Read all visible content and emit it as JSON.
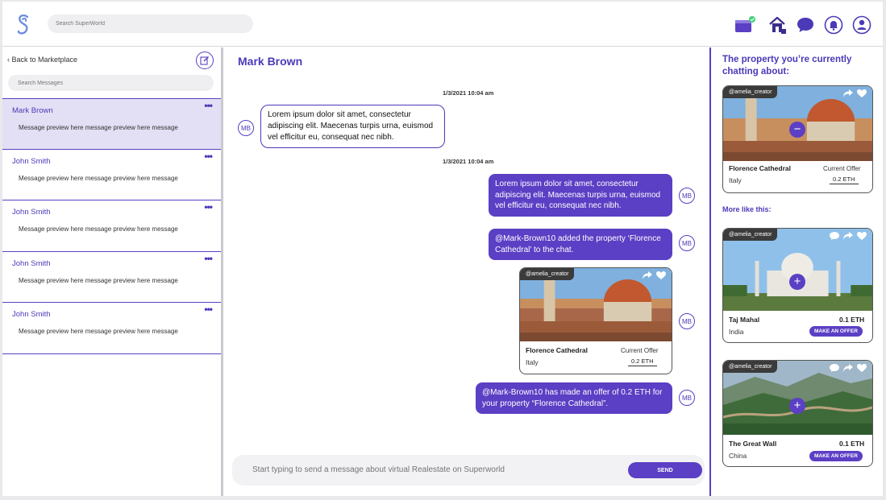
{
  "header": {
    "search_placeholder": "Search SuperWorld"
  },
  "sidebar": {
    "back_label": "Back to Marketplace",
    "search_placeholder": "Search Messages",
    "conversations": [
      {
        "name": "Mark Brown",
        "preview": "Message preview here message preview here message",
        "active": true
      },
      {
        "name": "John Smith",
        "preview": "Message preview here message preview here message"
      },
      {
        "name": "John Smith",
        "preview": "Message preview here message preview here message"
      },
      {
        "name": "John Smith",
        "preview": "Message preview here message preview here message"
      },
      {
        "name": "John Smith",
        "preview": "Message preview here message preview here message"
      }
    ],
    "more_glyph": "•••"
  },
  "chat": {
    "title": "Mark Brown",
    "timestamp_1": "1/3/2021 10:04 am",
    "timestamp_2": "1/3/2021 10:04 am",
    "avatar_initials": "MB",
    "msg_in_1": "Lorem ipsum dolor sit amet, consectetur adipiscing elit. Maecenas turpis urna, euismod vel efficitur eu, consequat nec nibh.",
    "msg_out_1": "Lorem ipsum dolor sit amet, consectetur adipiscing elit. Maecenas turpis urna, euismod vel efficitur eu, consequat nec nibh.",
    "msg_out_2": "@Mark-Brown10 added the property ‘Florence Cathedral’ to the chat.",
    "msg_out_3": "@Mark-Brown10 has made an offer of 0.2 ETH for your property “Florence Cathedral”.",
    "card": {
      "owner": "@amelia_creator",
      "name": "Florence Cathedral",
      "country": "Italy",
      "offer_label": "Current Offer",
      "offer_value": "0.2 ETH"
    },
    "composer_placeholder": "Start typing to send a message about virtual Realestate on Superworld",
    "send_label": "SEND"
  },
  "right": {
    "title": "The property you’re currently chatting about:",
    "current": {
      "owner": "@amelia_creator",
      "name": "Florence Cathedral",
      "country": "Italy",
      "offer_label": "Current Offer",
      "offer_value": "0.2 ETH"
    },
    "more_title": "More like this:",
    "suggestions": [
      {
        "owner": "@amelia_creator",
        "name": "Taj Mahal",
        "country": "India",
        "price": "0.1 ETH",
        "button": "MAKE AN OFFER"
      },
      {
        "owner": "@amelia_creator",
        "name": "The Great Wall",
        "country": "China",
        "price": "0.1 ETH",
        "button": "MAKE AN OFFER"
      }
    ]
  },
  "colors": {
    "accent": "#5b3fc4",
    "accent_text": "#4a3ab8",
    "active_row": "#e3dff5"
  }
}
